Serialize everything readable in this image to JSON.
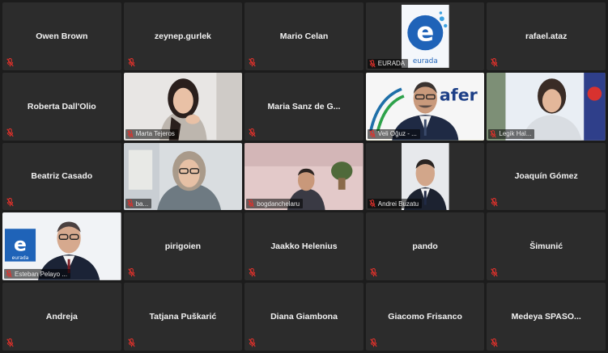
{
  "participants": [
    {
      "name": "Owen Brown",
      "video": false
    },
    {
      "name": "zeynep.gurlek",
      "video": false
    },
    {
      "name": "Mario Celan",
      "video": false
    },
    {
      "name": "EURADA",
      "video": true,
      "scene": "logo",
      "logo_text": "eurada"
    },
    {
      "name": "rafael.ataz",
      "video": false
    },
    {
      "name": "Roberta Dall'Olio",
      "video": false
    },
    {
      "name": "Marta Tejeros",
      "video": true,
      "scene": "girl"
    },
    {
      "name": "Maria Sanz de G...",
      "video": false
    },
    {
      "name": "Veli Oğuz - ...",
      "video": true,
      "scene": "speaker",
      "speaking": true,
      "backdrop_text": "afer"
    },
    {
      "name": "Legik Hal...",
      "video": true,
      "scene": "woman-right"
    },
    {
      "name": "Beatriz Casado",
      "video": false
    },
    {
      "name": "ba...",
      "video": true,
      "scene": "glasses-woman"
    },
    {
      "name": "bogdanchelaru",
      "video": true,
      "scene": "room"
    },
    {
      "name": "Andrei Buzatu",
      "video": true,
      "scene": "suit"
    },
    {
      "name": "Joaquín Gómez",
      "video": false
    },
    {
      "name": "Esteban Pelayo ...",
      "video": true,
      "scene": "man-logo",
      "logo_text": "eurada"
    },
    {
      "name": "pirigoien",
      "video": false
    },
    {
      "name": "Jaakko Helenius",
      "video": false
    },
    {
      "name": "pando",
      "video": false
    },
    {
      "name": "Šimunić",
      "video": false
    },
    {
      "name": "Andreja",
      "video": false
    },
    {
      "name": "Tatjana Puškarić",
      "video": false
    },
    {
      "name": "Diana Giambona",
      "video": false
    },
    {
      "name": "Giacomo Frisanco",
      "video": false
    },
    {
      "name": "Medeya SPASO...",
      "video": false
    }
  ],
  "colors": {
    "tile_bg": "#2c2c2c",
    "page_bg": "#1c1c1c",
    "mic_muted": "#e0312b",
    "active_speaker": "#d6d36b"
  },
  "icons": {
    "mic": "mic-muted-icon"
  }
}
